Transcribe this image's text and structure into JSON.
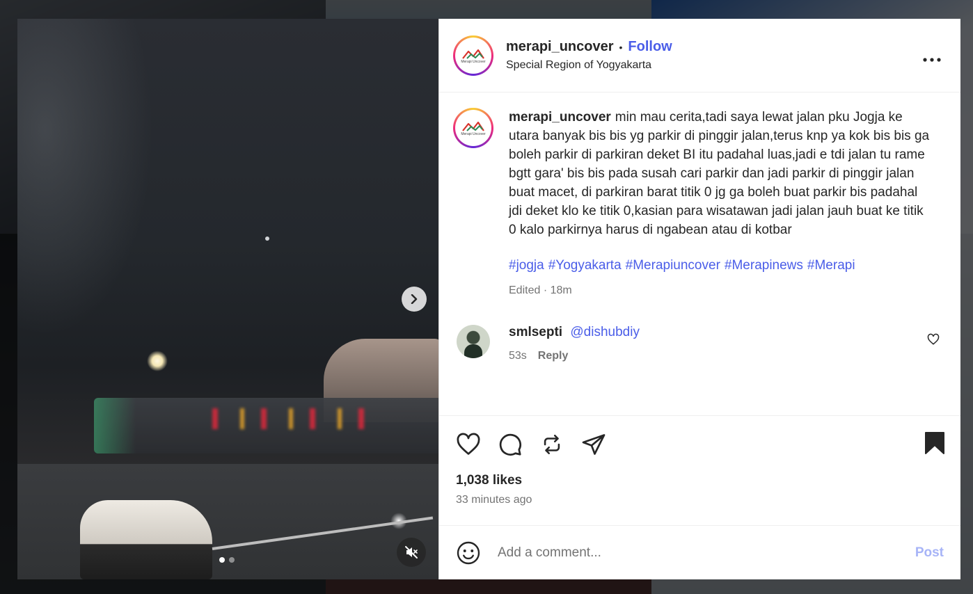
{
  "post": {
    "username": "merapi_uncover",
    "separator": "•",
    "follow_label": "Follow",
    "location": "Special Region of Yogyakarta",
    "more_label": "•••",
    "avatar_logo_text": "Merapi Uncover"
  },
  "caption": {
    "username": "merapi_uncover",
    "text": "min mau cerita,tadi saya lewat jalan pku Jogja ke utara banyak bis bis yg parkir di pinggir jalan,terus knp ya kok bis bis ga boleh parkir di parkiran deket BI itu padahal luas,jadi e tdi jalan tu rame bgtt gara' bis bis pada susah cari parkir dan jadi parkir di pinggir jalan buat macet, di parkiran barat titik 0 jg ga boleh buat parkir bis padahal jdi deket klo ke titik 0,kasian para wisatawan jadi jalan jauh buat ke titik 0 kalo parkirnya harus di ngabean atau di kotbar",
    "hashtags": [
      "#jogja",
      "#Yogyakarta",
      "#Merapiuncover",
      "#Merapinews",
      "#Merapi"
    ],
    "meta": "Edited · 18m"
  },
  "comments": [
    {
      "username": "smlsepti",
      "mention": "@dishubdiy",
      "time": "53s",
      "reply_label": "Reply"
    }
  ],
  "actions": {
    "likes": "1,038 likes",
    "time_ago": "33 minutes ago"
  },
  "composer": {
    "placeholder": "Add a comment...",
    "post_label": "Post"
  },
  "media": {
    "carousel_total": 2,
    "carousel_active": 1
  },
  "colors": {
    "link_blue": "#4a5de8",
    "post_disabled": "#a7b4f7",
    "muted": "#737373"
  }
}
